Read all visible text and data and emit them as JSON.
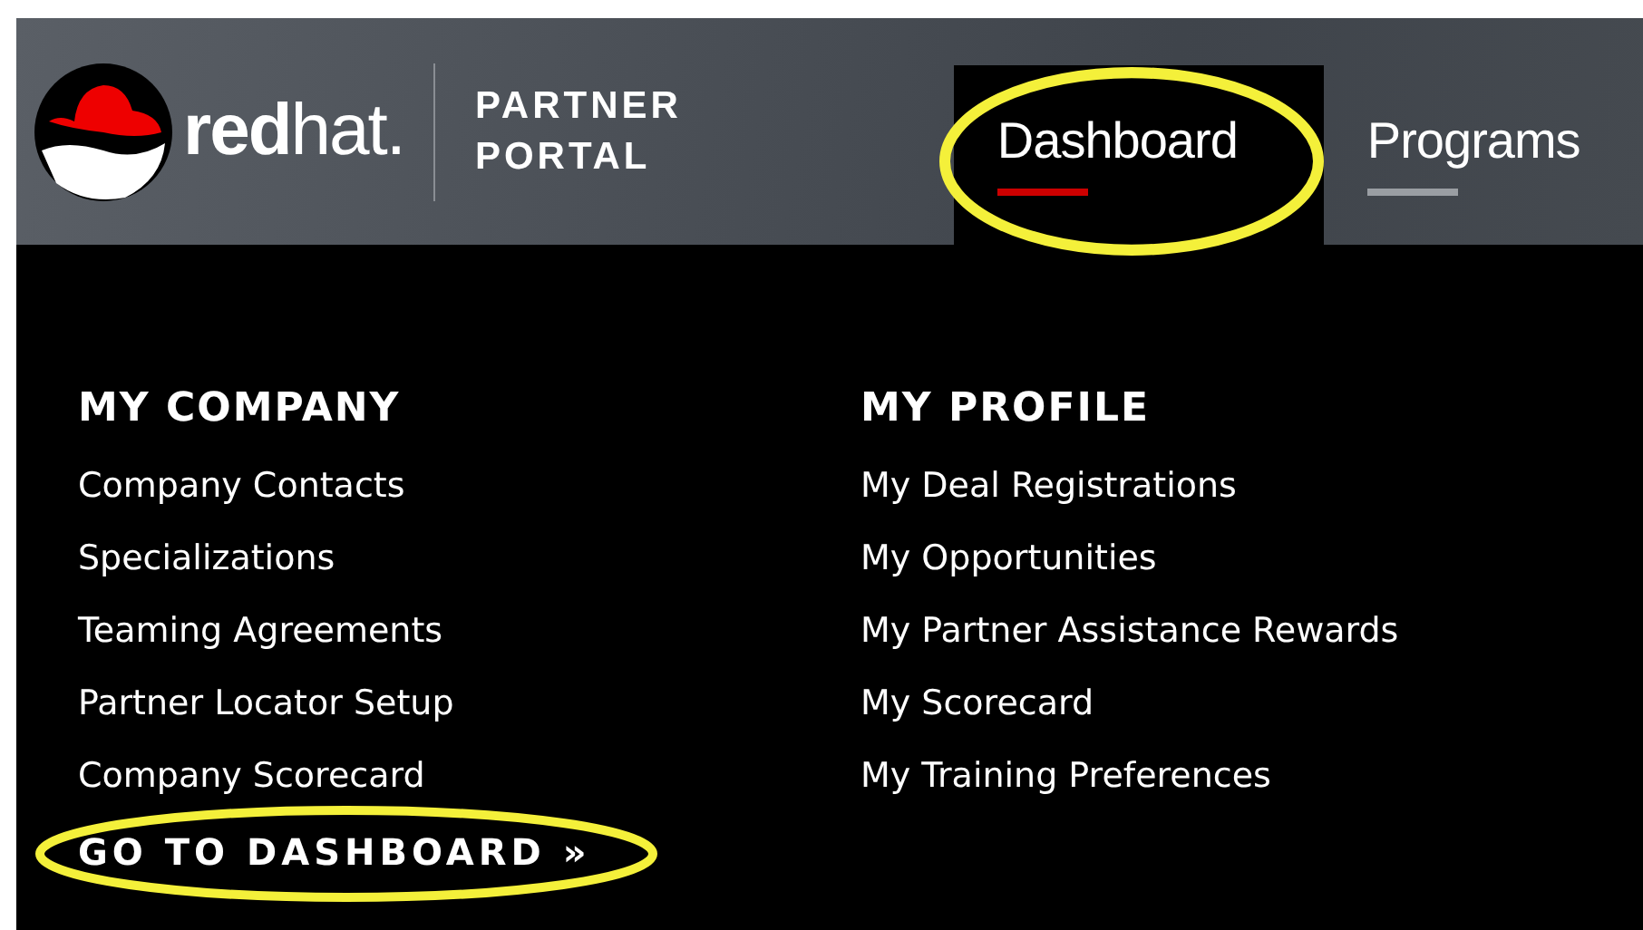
{
  "header": {
    "logo": "**red**hat.",
    "portal_title": [
      "PARTNER",
      "PORTAL"
    ]
  },
  "tabs": [
    {
      "label": "Dashboard",
      "selected": true,
      "circled": true
    },
    {
      "label": "Programs",
      "selected": false,
      "circled": false
    }
  ],
  "columns": [
    {
      "heading": "MY COMPANY",
      "items": [
        "Company Contacts",
        "Specializations",
        "Teaming Agreements",
        "Partner Locator Setup",
        "Company Scorecard"
      ]
    },
    {
      "heading": "MY PROFILE",
      "items": [
        "My Deal Registrations",
        "My Opportunities",
        "My Partner Assistance Rewards",
        "My Scorecard",
        "My Training Preferences"
      ]
    }
  ],
  "dashboard_link": {
    "label": "GO TO DASHBOARD »",
    "circled": true
  }
}
